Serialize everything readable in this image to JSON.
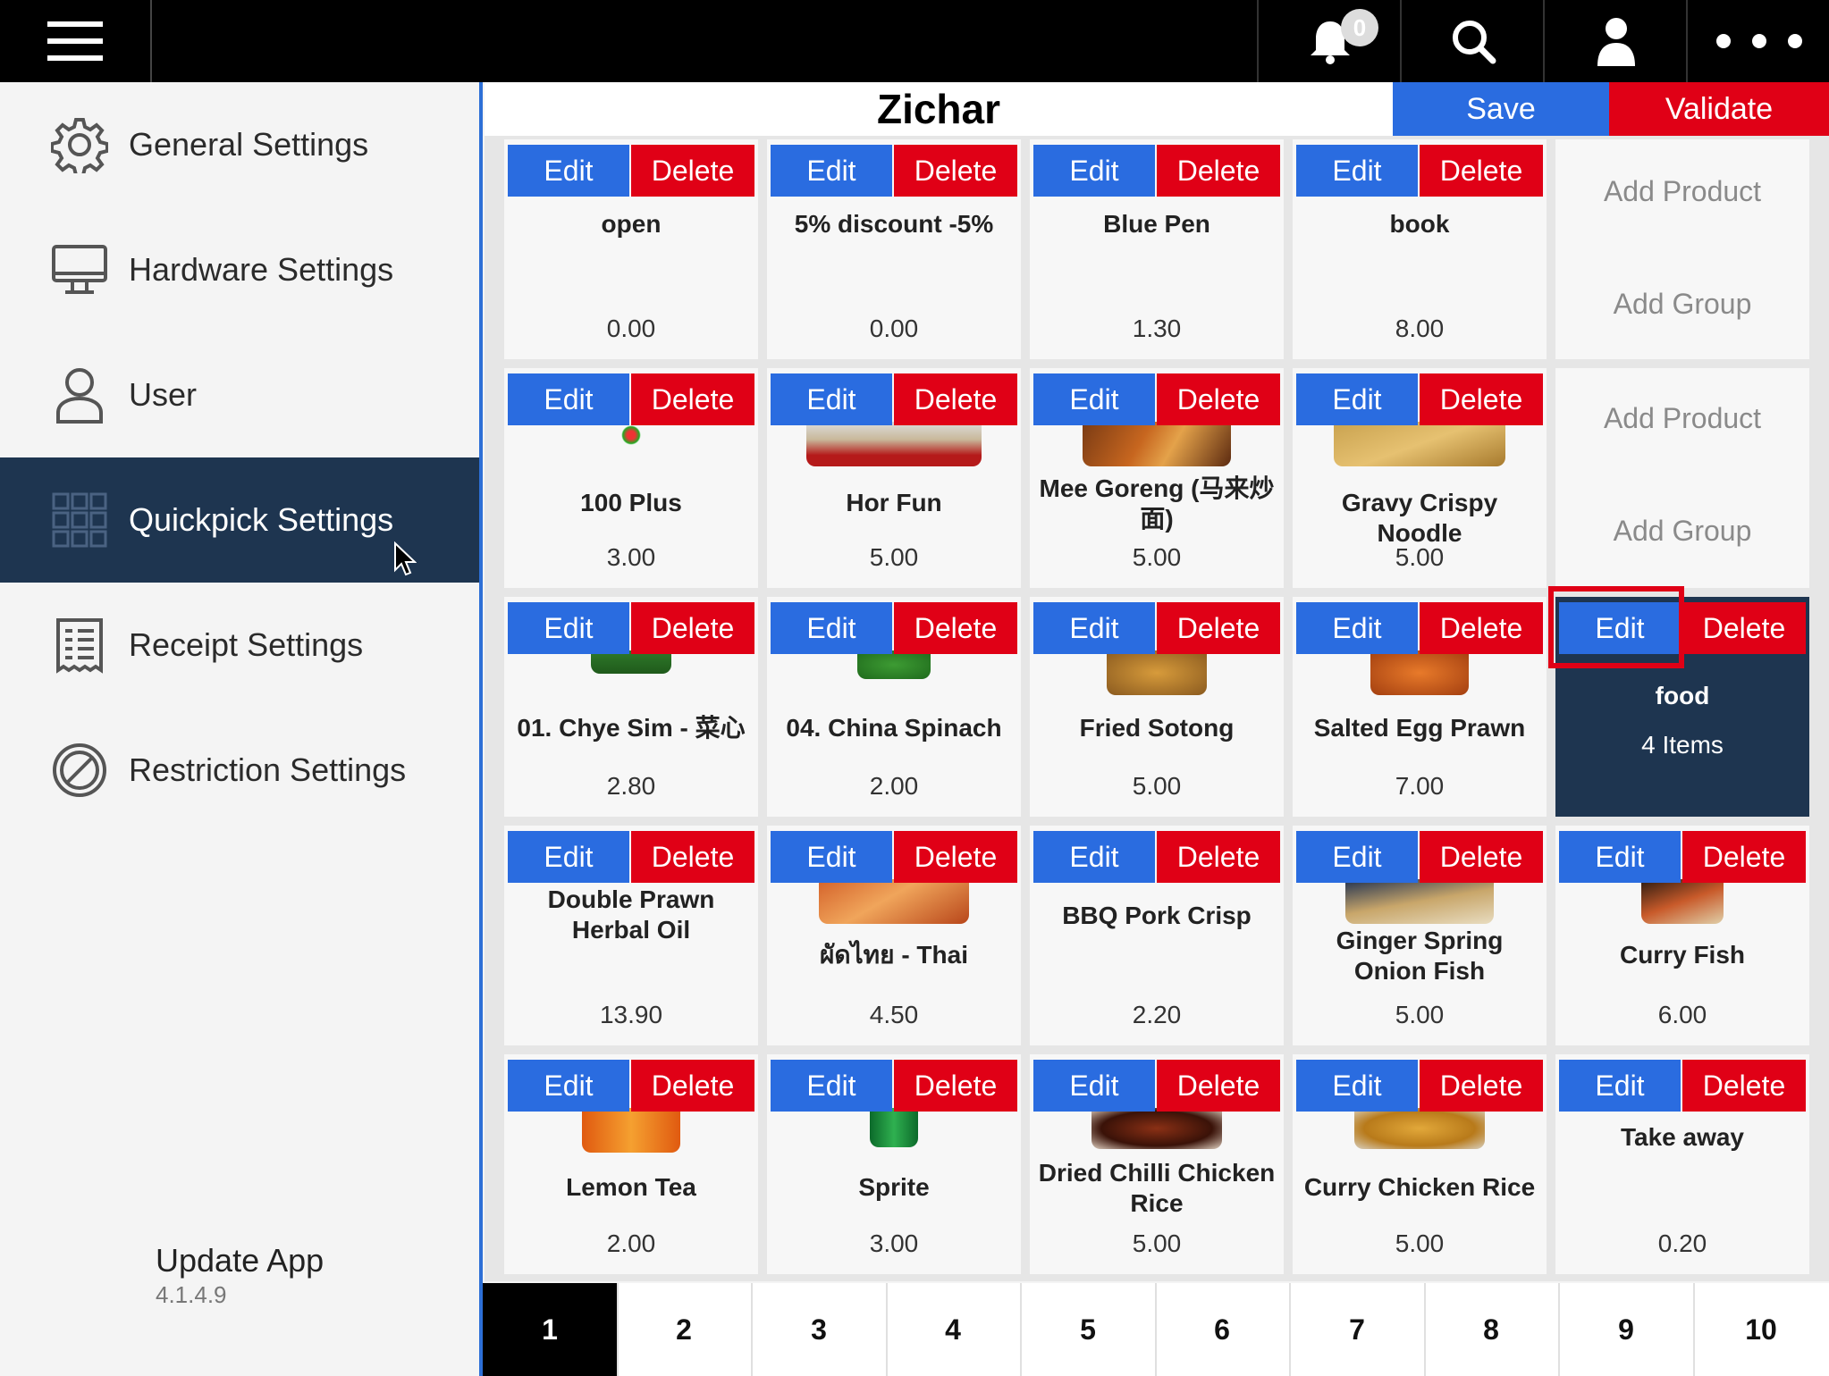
{
  "topbar": {
    "notification_count": "0",
    "icons": [
      "menu-icon",
      "bell-icon",
      "search-icon",
      "user-icon",
      "more-icon"
    ]
  },
  "sidebar": {
    "items": [
      {
        "label": "General Settings",
        "icon": "gear-icon"
      },
      {
        "label": "Hardware Settings",
        "icon": "monitor-icon"
      },
      {
        "label": "User",
        "icon": "user-icon"
      },
      {
        "label": "Quickpick Settings",
        "icon": "grid-icon",
        "active": true
      },
      {
        "label": "Receipt Settings",
        "icon": "receipt-icon"
      },
      {
        "label": "Restriction Settings",
        "icon": "prohibited-icon"
      }
    ],
    "update_label": "Update App",
    "version": "4.1.4.9"
  },
  "header": {
    "title": "Zichar",
    "save_label": "Save",
    "validate_label": "Validate"
  },
  "buttons": {
    "edit": "Edit",
    "delete": "Delete",
    "add_product": "Add Product",
    "add_group": "Add Group"
  },
  "tiles": [
    [
      {
        "name": "open",
        "price": "0.00"
      },
      {
        "name": "5% discount -5%",
        "price": "0.00"
      },
      {
        "name": "Blue Pen",
        "price": "1.30"
      },
      {
        "name": "book",
        "price": "8.00"
      },
      {
        "empty": true
      }
    ],
    [
      {
        "name": "100 Plus",
        "price": "3.00"
      },
      {
        "name": "Hor Fun",
        "price": "5.00"
      },
      {
        "name": "Mee Goreng (马来炒面)",
        "price": "5.00"
      },
      {
        "name": "Gravy Crispy Noodle",
        "price": "5.00"
      },
      {
        "empty": true
      }
    ],
    [
      {
        "name": "01. Chye Sim - 菜心",
        "price": "2.80"
      },
      {
        "name": "04. China Spinach",
        "price": "2.00"
      },
      {
        "name": "Fried Sotong",
        "price": "5.00"
      },
      {
        "name": "Salted Egg Prawn",
        "price": "7.00"
      },
      {
        "name": "food",
        "group": true,
        "count": "4 Items"
      }
    ],
    [
      {
        "name": "Double Prawn Herbal Oil",
        "price": "13.90"
      },
      {
        "name": "ผัดไทย - Thai",
        "price": "4.50"
      },
      {
        "name": "BBQ Pork Crisp",
        "price": "2.20"
      },
      {
        "name": "Ginger Spring Onion Fish",
        "price": "5.00"
      },
      {
        "name": "Curry Fish",
        "price": "6.00"
      }
    ],
    [
      {
        "name": "Lemon Tea",
        "price": "2.00"
      },
      {
        "name": "Sprite",
        "price": "3.00"
      },
      {
        "name": "Dried Chilli Chicken Rice",
        "price": "5.00"
      },
      {
        "name": "Curry Chicken Rice",
        "price": "5.00"
      },
      {
        "name": "Take away",
        "price": "0.20"
      }
    ]
  ],
  "pager": {
    "pages": [
      "1",
      "2",
      "3",
      "4",
      "5",
      "6",
      "7",
      "8",
      "9",
      "10"
    ],
    "active": "1"
  },
  "colors": {
    "blue": "#2a6ce0",
    "red": "#e00016",
    "navy": "#1e3550"
  }
}
